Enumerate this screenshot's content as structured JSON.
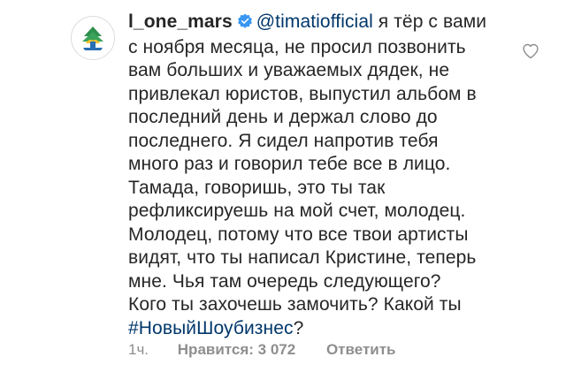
{
  "comment": {
    "username": "l_one_mars",
    "verified": true,
    "mention": "@timatiofficial",
    "line1_rest": " я тёр с вами",
    "lines": [
      "с ноября месяца, не просил позвонить",
      "вам больших и уважаемых дядек, не",
      "привлекал юристов, выпустил альбом в",
      "последний день и держал слово до",
      "последнего. Я сидел напротив тебя",
      "много раз и говорил тебе все в лицо.",
      "Тамада, говоришь, это ты так",
      "рефликсируешь на мой счет, молодец.",
      "Молодец, потому что все твои артисты",
      "видят, что ты написал Кристине, теперь",
      "мне. Чья там очередь следующего?",
      "Кого ты захочешь замочить?  Какой ты"
    ],
    "hashtag": "#НовыйШоубизнес",
    "hashtag_suffix": "?",
    "time": "1ч.",
    "likes_label": "Нравится: 3 072",
    "reply_label": "Ответить",
    "icons": {
      "avatar": "user-avatar",
      "verified": "verified-badge-icon",
      "like": "heart-icon"
    },
    "colors": {
      "text": "#262626",
      "link": "#00376b",
      "meta": "#8e8e8e",
      "verified": "#3897f0"
    }
  }
}
